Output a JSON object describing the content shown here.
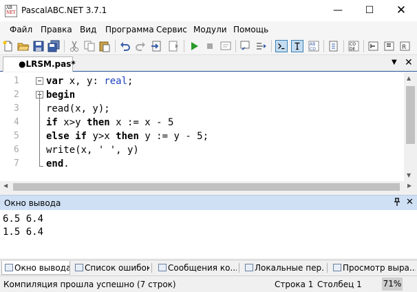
{
  "window": {
    "title": "PascalABC.NET 3.7.1",
    "app_icon_text": [
      "AB",
      "NET"
    ],
    "minimize_glyph": "—",
    "maximize_glyph": "☐",
    "close_glyph": "✕"
  },
  "menu": [
    "Файл",
    "Правка",
    "Вид",
    "Программа",
    "Сервис",
    "Модули",
    "Помощь"
  ],
  "toolbar": {
    "icons": [
      "new-file-icon",
      "open-folder-icon",
      "save-icon",
      "save-all-icon",
      "cut-icon",
      "copy-icon",
      "paste-icon",
      "undo-icon",
      "redo-icon",
      "compile-icon",
      "step-icon",
      "run-icon",
      "stop-icon",
      "watch-icon",
      "debug-icon",
      "output-window-icon",
      "text-icon",
      "format-icon",
      "module-icon",
      "code-template-icon",
      "structure-icon",
      "form-icon",
      "help-icon"
    ]
  },
  "tab": {
    "label": "●LRSM.pas*",
    "dropdown_glyph": "▼",
    "close_glyph": "✕"
  },
  "editor": {
    "line_numbers": [
      "1",
      "2",
      "3",
      "4",
      "5",
      "6",
      "7"
    ],
    "lines": [
      [
        {
          "t": "var",
          "c": "kw"
        },
        {
          "t": " x, y: ",
          "c": "nm"
        },
        {
          "t": "real",
          "c": "ty"
        },
        {
          "t": ";",
          "c": "nm"
        }
      ],
      [
        {
          "t": "begin",
          "c": "kw"
        }
      ],
      [
        {
          "t": "read(x, y);",
          "c": "nm"
        }
      ],
      [
        {
          "t": "if",
          "c": "kw"
        },
        {
          "t": " x>y ",
          "c": "nm"
        },
        {
          "t": "then",
          "c": "kw"
        },
        {
          "t": " x := x - 5",
          "c": "nm"
        }
      ],
      [
        {
          "t": "else",
          "c": "kw"
        },
        {
          "t": " ",
          "c": "nm"
        },
        {
          "t": "if",
          "c": "kw"
        },
        {
          "t": " y>x ",
          "c": "nm"
        },
        {
          "t": "then",
          "c": "kw"
        },
        {
          "t": " y := y - 5;",
          "c": "nm"
        }
      ],
      [
        {
          "t": "write(x, ' ', y)",
          "c": "nm"
        }
      ],
      [
        {
          "t": "end",
          "c": "kw"
        },
        {
          "t": ".",
          "c": "nm"
        }
      ]
    ]
  },
  "output_panel": {
    "title": "Окно вывода",
    "pin_glyph": "📌",
    "close_glyph": "✕",
    "lines": [
      "6.5 6.4",
      "1.5 6.4"
    ]
  },
  "bottom_tabs": [
    "Окно вывода",
    "Список ошибок",
    "Сообщения ко...",
    "Локальные пер...",
    "Просмотр выра..."
  ],
  "status": {
    "message": "Компиляция прошла успешно (7 строк)",
    "row": "Строка  1",
    "col": "Столбец  1",
    "zoom": "71%"
  },
  "colors": {
    "keyword": "#000000",
    "type": "#1a3fbf",
    "panel_header": "#cfe0f5"
  }
}
